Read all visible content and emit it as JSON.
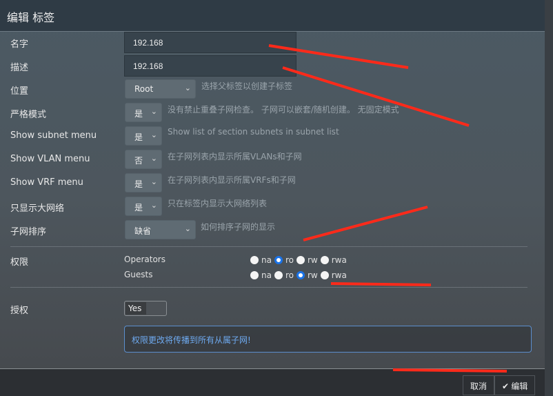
{
  "modal": {
    "title": "编辑 标签"
  },
  "form": {
    "name": {
      "label": "名字",
      "value": "192.168"
    },
    "description": {
      "label": "描述",
      "value": "192.168"
    },
    "location": {
      "label": "位置",
      "value": "Root",
      "help": "选择父标签以创建子标签"
    },
    "strict_mode": {
      "label": "严格模式",
      "value": "是",
      "help": "没有禁止重叠子网检查。 子网可以嵌套/随机创建。 无固定模式"
    },
    "show_subnet": {
      "label": "Show subnet menu",
      "value": "是",
      "help": "Show list of section subnets in subnet list"
    },
    "show_vlan": {
      "label": "Show VLAN menu",
      "value": "否",
      "help": "在子网列表内显示所属VLANs和子网"
    },
    "show_vrf": {
      "label": "Show VRF menu",
      "value": "是",
      "help": "在子网列表内显示所属VRFs和子网"
    },
    "show_supernets": {
      "label": "只显示大网络",
      "value": "是",
      "help": "只在标签内显示大网络列表"
    },
    "subnet_order": {
      "label": "子网排序",
      "value": "缺省",
      "help": "如何排序子网的显示"
    }
  },
  "permissions": {
    "label": "权限",
    "options": [
      "na",
      "ro",
      "rw",
      "rwa"
    ],
    "groups": [
      {
        "name": "Operators",
        "selected": "ro"
      },
      {
        "name": "Guests",
        "selected": "rw"
      }
    ]
  },
  "authorize": {
    "label": "授权",
    "toggle": "Yes"
  },
  "alert": "权限更改将传播到所有从属子网!",
  "footer": {
    "cancel": "取消",
    "submit": "编辑",
    "submit_icon": "check-icon"
  },
  "colors": {
    "accent": "#1a73e8",
    "annotation_arrow": "#ff2a1a"
  }
}
